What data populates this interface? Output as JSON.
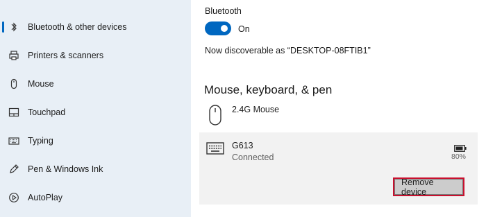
{
  "sidebar": {
    "items": [
      {
        "label": "Bluetooth & other devices",
        "icon": "bluetooth-icon",
        "selected": true
      },
      {
        "label": "Printers & scanners",
        "icon": "printer-icon"
      },
      {
        "label": "Mouse",
        "icon": "mouse-icon"
      },
      {
        "label": "Touchpad",
        "icon": "touchpad-icon"
      },
      {
        "label": "Typing",
        "icon": "keyboard-icon"
      },
      {
        "label": "Pen & Windows Ink",
        "icon": "pen-icon"
      },
      {
        "label": "AutoPlay",
        "icon": "autoplay-icon"
      }
    ]
  },
  "bluetooth": {
    "label": "Bluetooth",
    "toggle_state": "On",
    "discoverable_text": "Now discoverable as “DESKTOP-08FTIB1”"
  },
  "devices": {
    "section_title": "Mouse, keyboard, & pen",
    "mouse": {
      "name": "2.4G Mouse",
      "icon": "mouse-icon"
    },
    "keyboard": {
      "name": "G613",
      "status": "Connected",
      "battery": "80%",
      "icon": "keyboard-icon",
      "remove_label": "Remove device"
    }
  },
  "colors": {
    "accent": "#0067c0",
    "sidebar_bg": "#e8eff6",
    "card_bg": "#f2f2f2",
    "highlight": "#c8102e"
  }
}
